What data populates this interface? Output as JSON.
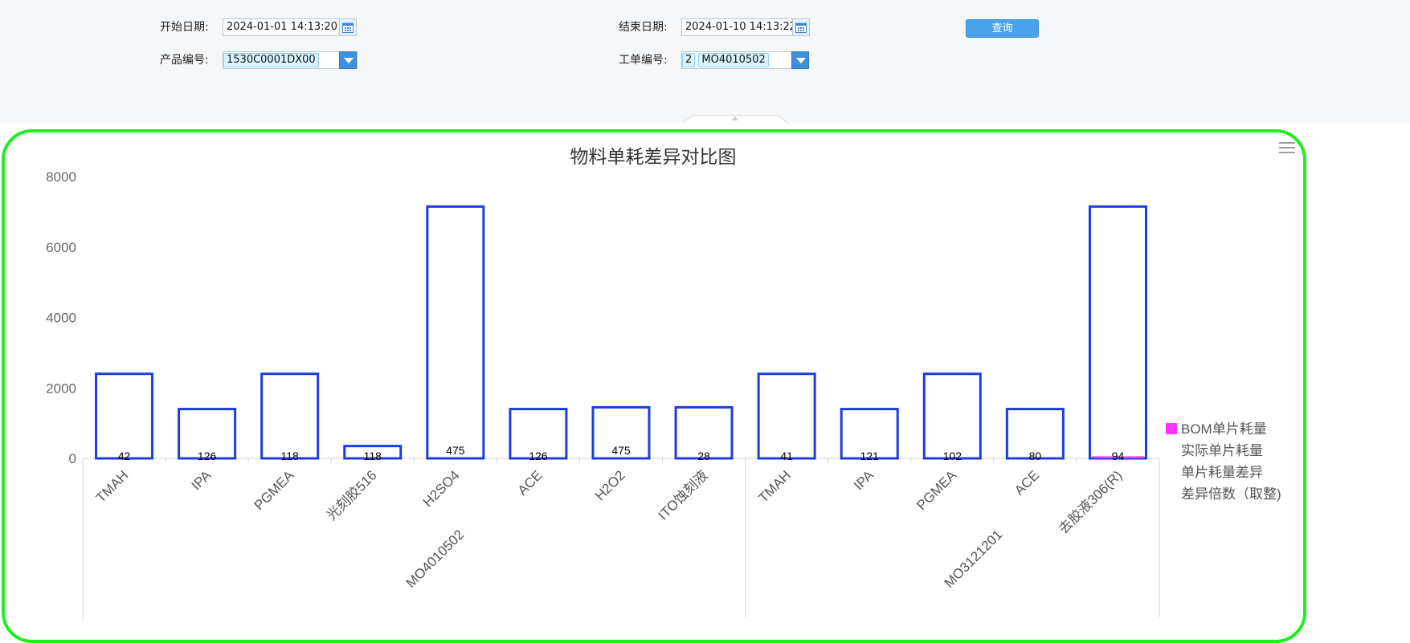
{
  "filters": {
    "start_date_label": "开始日期:",
    "start_date_value": "2024-01-01 14:13:20",
    "end_date_label": "结束日期:",
    "end_date_value": "2024-01-10 14:13:22",
    "product_label": "产品编号:",
    "product_value": "1530C0001DX00",
    "workorder_label": "工单编号:",
    "workorder_prefix": "2",
    "workorder_value": "MO4010502",
    "query_button": "查询"
  },
  "chart_data": {
    "type": "bar",
    "title": "物料单耗差异对比图",
    "xlabel": "",
    "ylabel": "",
    "ylim": [
      0,
      8000
    ],
    "yticks": [
      0,
      2000,
      4000,
      6000,
      8000
    ],
    "grid": false,
    "legend_position": "right",
    "groups": [
      {
        "name": "MO4010502",
        "categories": [
          "TMAH",
          "IPA",
          "PGMEA",
          "光刻胶516",
          "H2SO4",
          "ACE",
          "H2O2",
          "ITO蚀刻液"
        ]
      },
      {
        "name": "MO3121201",
        "categories": [
          "TMAH",
          "IPA",
          "PGMEA",
          "ACE",
          "去胶液306(R)"
        ]
      }
    ],
    "categories": [
      "TMAH",
      "IPA",
      "PGMEA",
      "光刻胶516",
      "H2SO4",
      "ACE",
      "H2O2",
      "ITO蚀刻液",
      "TMAH",
      "IPA",
      "PGMEA",
      "ACE",
      "去胶液306(R)"
    ],
    "series": [
      {
        "name": "BOM单片耗量",
        "color": "#ff33ff",
        "values": [
          2,
          2,
          2,
          2,
          2,
          2,
          2,
          2,
          2,
          2,
          2,
          2,
          60
        ]
      },
      {
        "name": "实际单片耗量",
        "color": "#1a3de0",
        "values": [
          2400,
          1400,
          2400,
          350,
          7150,
          1400,
          1450,
          1450,
          2400,
          1400,
          2400,
          1400,
          7150
        ]
      },
      {
        "name": "单片耗量差异",
        "color": "#000000",
        "values": []
      },
      {
        "name": "差异倍数（取整)",
        "color": "#000000",
        "values": []
      }
    ],
    "data_labels": [
      "42",
      "126",
      "118",
      "118",
      "475",
      "126",
      "475",
      "28",
      "41",
      "121",
      "102",
      "80",
      "94"
    ]
  }
}
